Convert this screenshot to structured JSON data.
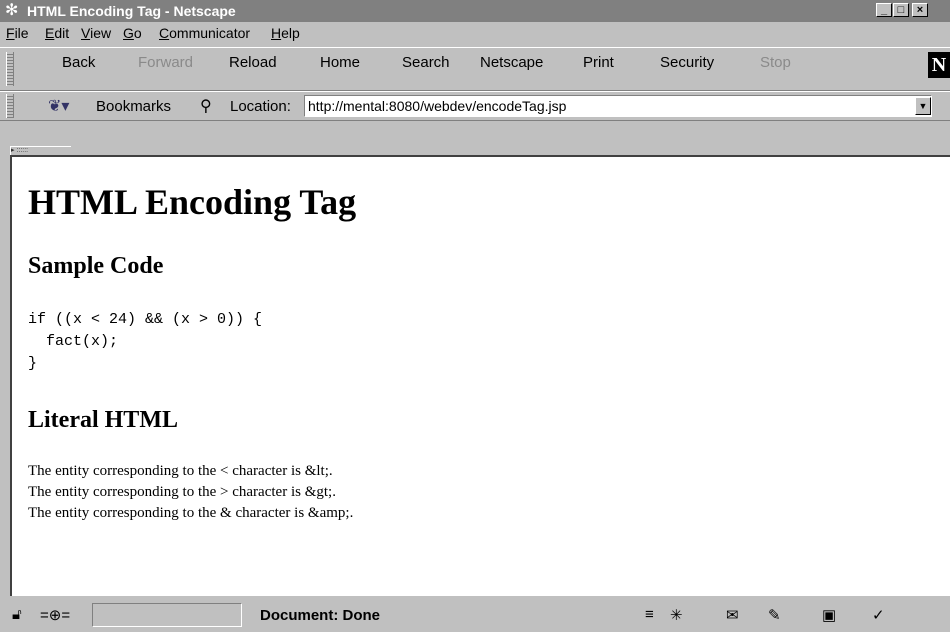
{
  "window": {
    "title": "HTML Encoding Tag - Netscape",
    "controls": {
      "minimize": "_",
      "maximize": "□",
      "close": "×"
    }
  },
  "menubar": {
    "items": [
      {
        "label": "File",
        "accel": "F"
      },
      {
        "label": "Edit",
        "accel": "E"
      },
      {
        "label": "View",
        "accel": "V"
      },
      {
        "label": "Go",
        "accel": "G"
      },
      {
        "label": "Communicator",
        "accel": "C"
      },
      {
        "label": "Help",
        "accel": "H"
      }
    ]
  },
  "toolbar": {
    "back": "Back",
    "forward": "Forward",
    "reload": "Reload",
    "home": "Home",
    "search": "Search",
    "netscape": "Netscape",
    "print": "Print",
    "security": "Security",
    "stop": "Stop",
    "logo": "N"
  },
  "location": {
    "bookmarks_label": "Bookmarks",
    "location_label": "Location:",
    "url": "http://mental:8080/webdev/encodeTag.jsp"
  },
  "page": {
    "heading": "HTML Encoding Tag",
    "section1": "Sample Code",
    "code": "if ((x < 24) && (x > 0)) {\n  fact(x);\n}",
    "section2": "Literal HTML",
    "lines": [
      "The entity corresponding to the < character is &lt;.",
      "The entity corresponding to the > character is &gt;.",
      "The entity corresponding to the & character is &amp;."
    ]
  },
  "status": {
    "text": "Document: Done"
  }
}
